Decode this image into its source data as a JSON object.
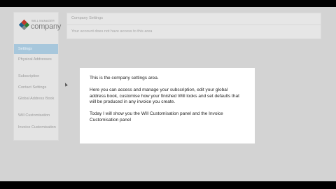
{
  "logo": {
    "small_text": "WILL MANAGER",
    "brand": "company",
    "colors": [
      "#c0392b",
      "#2e7d32",
      "#1f5f8b",
      "#7f8c8d"
    ]
  },
  "sidebar": {
    "items": [
      {
        "label": "Settings",
        "active": true
      },
      {
        "label": "Physical Addresses"
      },
      {
        "label": "Subscription"
      },
      {
        "label": "Contact Settings"
      },
      {
        "label": "Global Address Book"
      },
      {
        "label": "Will Customisation"
      },
      {
        "label": "Invoice Customisation"
      }
    ]
  },
  "panel": {
    "title": "Company Settings",
    "message": "Your account does not have access to this area"
  },
  "dialog": {
    "paragraphs": [
      "This is the company settings area.",
      "Here you can access and manage your subscription, edit your global address book, customise how your finished Will looks and set defaults that will be produced in any invoice you create.",
      "Today I will show you the Will Customisation panel and the Invoice Customisation panel"
    ]
  },
  "colors": {
    "active_nav": "#a7c7dc",
    "background": "#d3d3d3",
    "letterbox": "#000000"
  }
}
